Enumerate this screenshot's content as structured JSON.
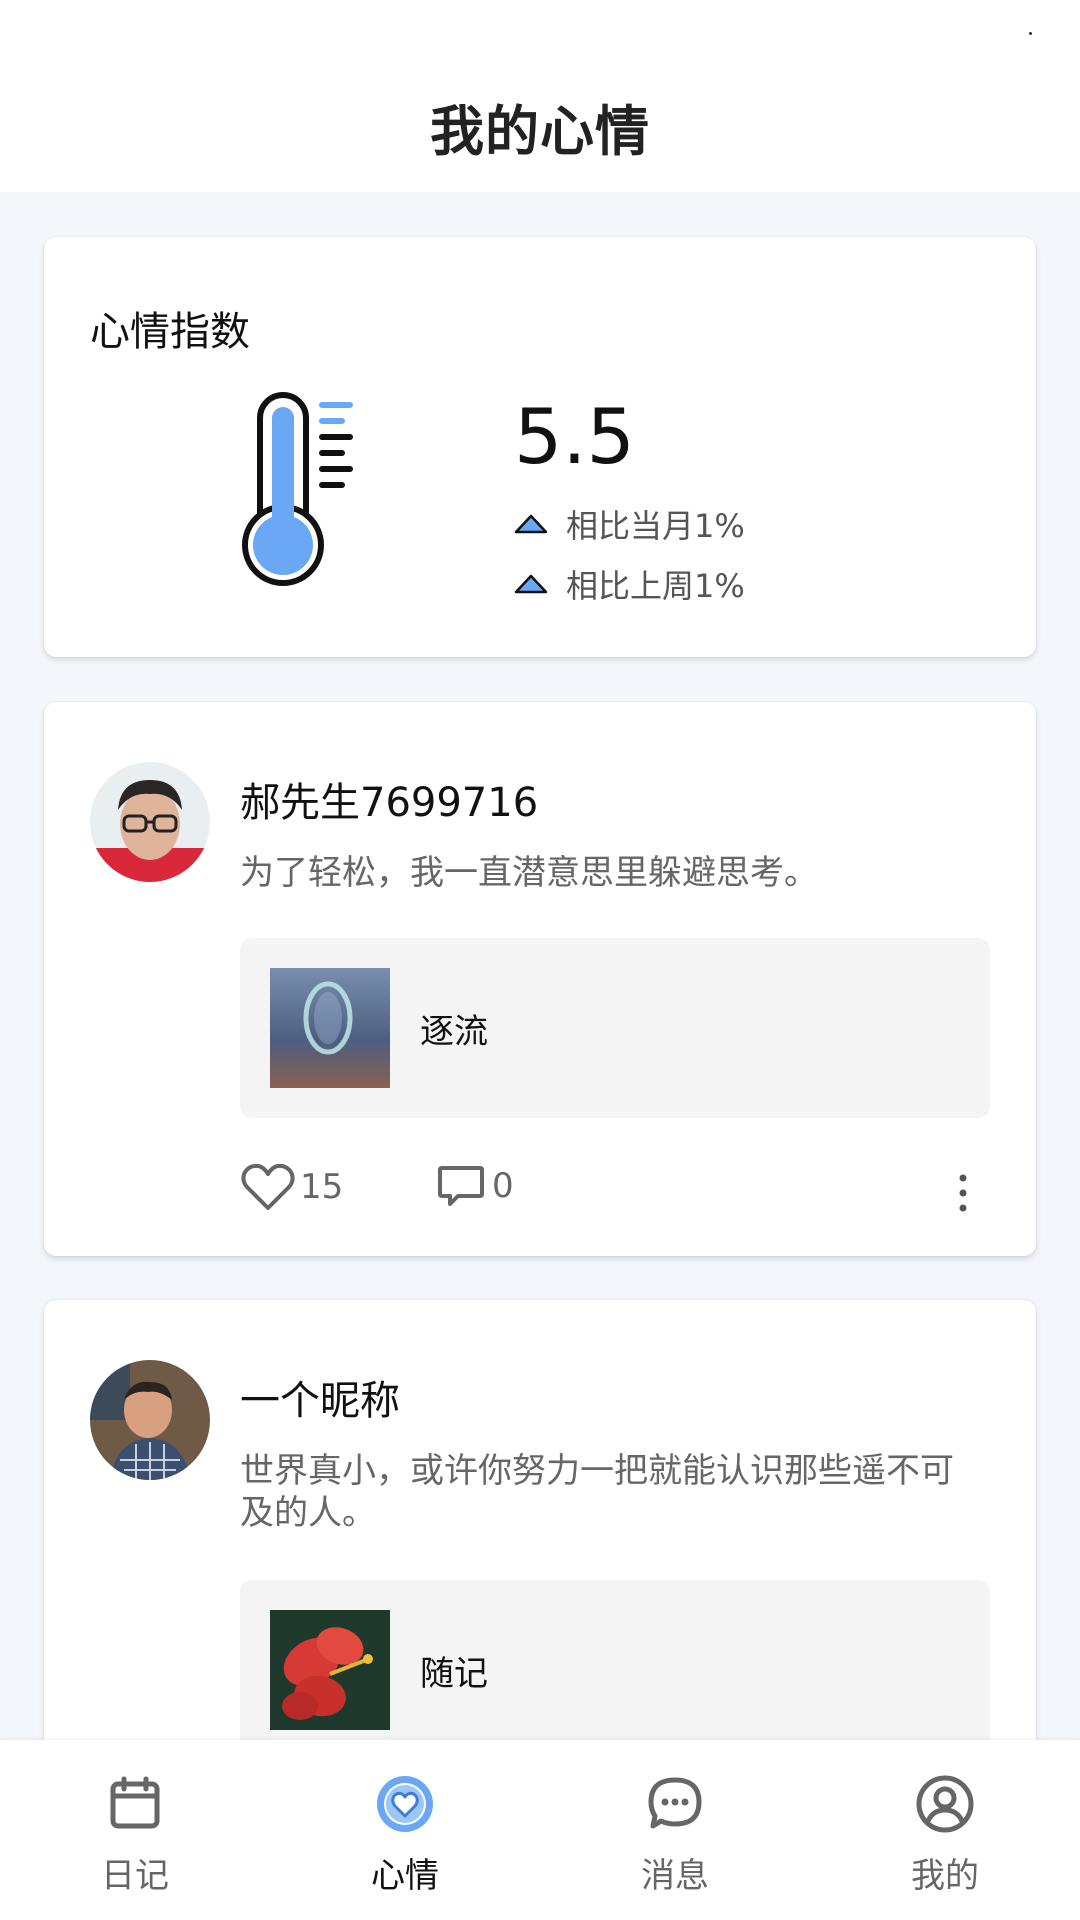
{
  "header": {
    "title": "我的心情"
  },
  "mood": {
    "title": "心情指数",
    "value": "5.5",
    "compare_month": "相比当月1%",
    "compare_week": "相比上周1%"
  },
  "posts": [
    {
      "name": "郝先生7699716",
      "text": "为了轻松，我一直潜意思里躲避思考。",
      "attachment_label": "逐流",
      "likes": "15",
      "comments": "0"
    },
    {
      "name": "一个昵称",
      "text": "世界真小，或许你努力一把就能认识那些遥不可及的人。",
      "attachment_label": "随记"
    }
  ],
  "tabs": [
    {
      "label": "日记",
      "icon": "calendar-icon"
    },
    {
      "label": "心情",
      "icon": "heart-icon",
      "active": true
    },
    {
      "label": "消息",
      "icon": "chat-icon"
    },
    {
      "label": "我的",
      "icon": "user-icon"
    }
  ],
  "colors": {
    "accent": "#6aa8f5",
    "background": "#f3f6fb",
    "card": "#ffffff",
    "muted_text": "#666666"
  }
}
